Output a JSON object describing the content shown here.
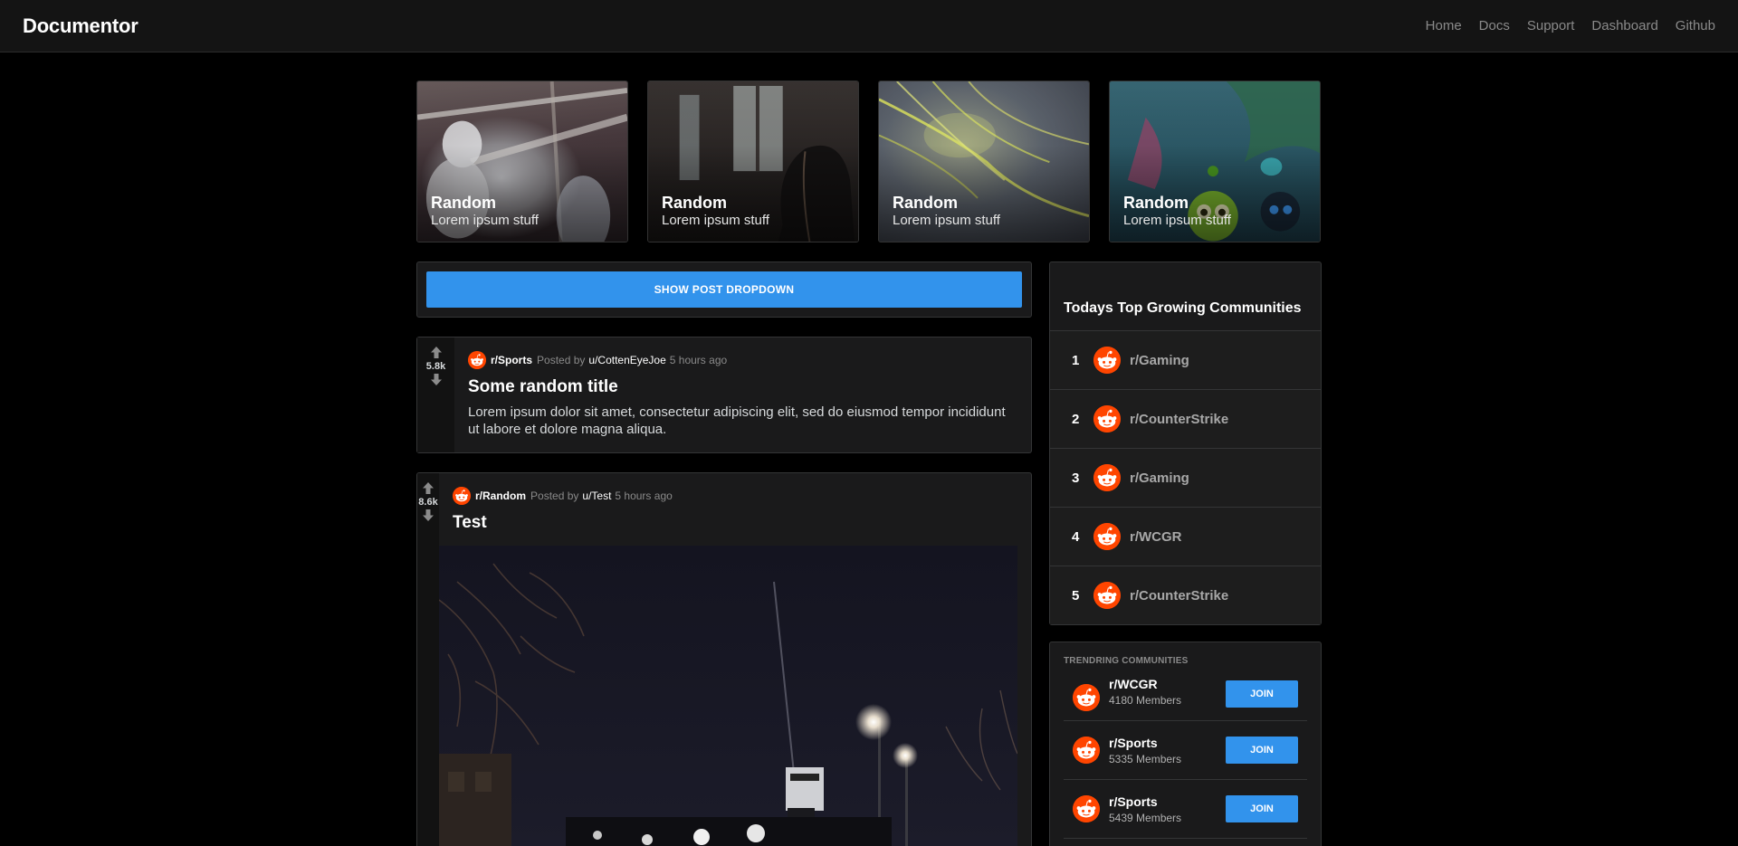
{
  "navbar": {
    "brand": "Documentor",
    "links": [
      "Home",
      "Docs",
      "Support",
      "Dashboard",
      "Github"
    ]
  },
  "cards": [
    {
      "title": "Random",
      "subtitle": "Lorem ipsum stuff"
    },
    {
      "title": "Random",
      "subtitle": "Lorem ipsum stuff"
    },
    {
      "title": "Random",
      "subtitle": "Lorem ipsum stuff"
    },
    {
      "title": "Random",
      "subtitle": "Lorem ipsum stuff"
    }
  ],
  "feed": {
    "dropdown_label": "SHOW POST DROPDOWN",
    "posts": [
      {
        "votes": "5.8k",
        "subreddit": "r/Sports",
        "posted_by_prefix": "Posted by",
        "user": "u/CottenEyeJoe",
        "time": "5 hours ago",
        "title": "Some random title",
        "text": "Lorem ipsum dolor sit amet, consectetur adipiscing elit, sed do eiusmod tempor incididunt ut labore et dolore magna aliqua."
      },
      {
        "votes": "8.6k",
        "subreddit": "r/Random",
        "posted_by_prefix": "Posted by",
        "user": "u/Test",
        "time": "5 hours ago",
        "title": "Test"
      }
    ]
  },
  "sidebar": {
    "top_title": "Todays Top Growing Communities",
    "top": [
      {
        "rank": "1",
        "name": "r/Gaming"
      },
      {
        "rank": "2",
        "name": "r/CounterStrike"
      },
      {
        "rank": "3",
        "name": "r/Gaming"
      },
      {
        "rank": "4",
        "name": "r/WCGR"
      },
      {
        "rank": "5",
        "name": "r/CounterStrike"
      }
    ],
    "trending_title": "TRENDRING COMMUNITIES",
    "trending": [
      {
        "name": "r/WCGR",
        "members": "4180 Members",
        "join": "JOIN"
      },
      {
        "name": "r/Sports",
        "members": "5335 Members",
        "join": "JOIN"
      },
      {
        "name": "r/Sports",
        "members": "5439 Members",
        "join": "JOIN"
      }
    ]
  },
  "colors": {
    "accent": "#3293ec",
    "reddit_orange": "#ff4500",
    "card_bg": "#1a1a1b",
    "navbar_bg": "#141414"
  },
  "icons": [
    "upvote-icon",
    "downvote-icon",
    "reddit-avatar-icon"
  ]
}
